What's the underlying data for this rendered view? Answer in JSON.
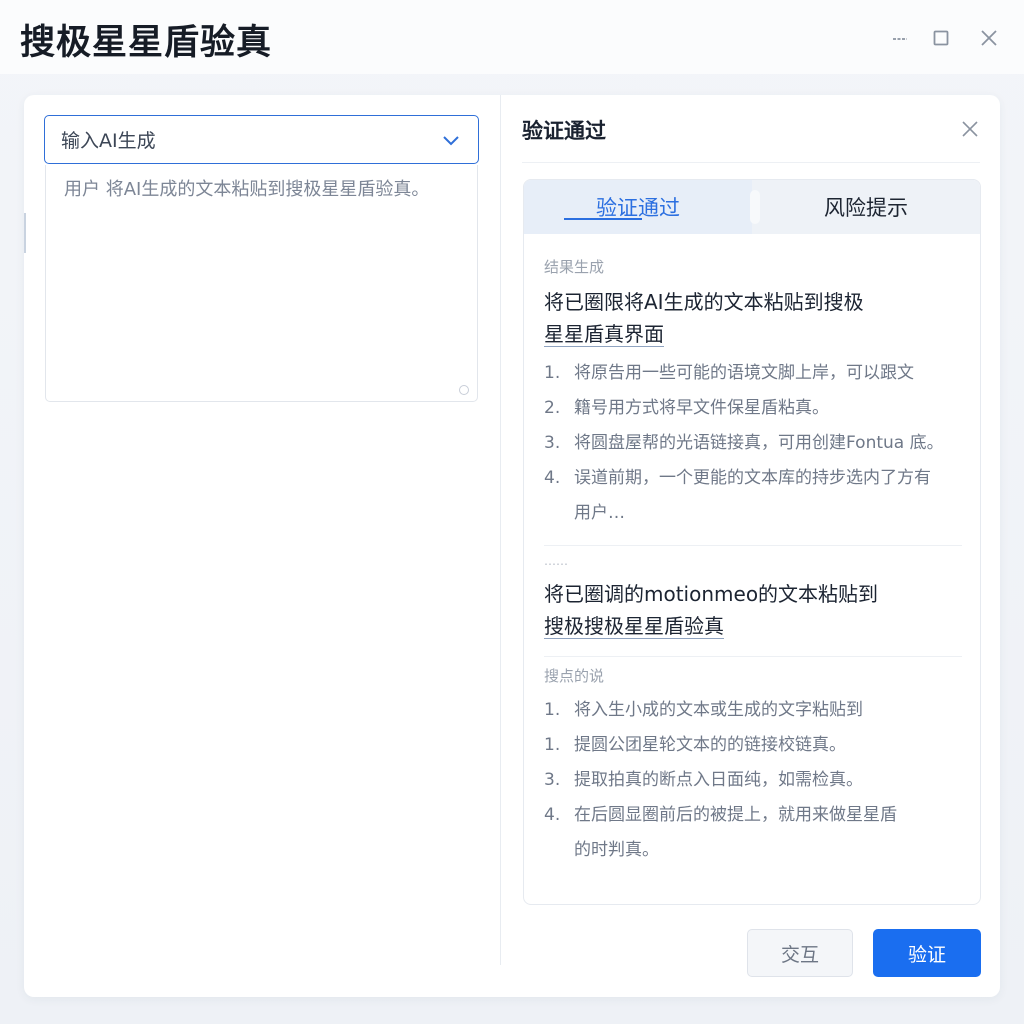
{
  "window": {
    "title": "搜极星星盾验真"
  },
  "left": {
    "select_value": "输入AI生成",
    "textarea_placeholder": "用户 将AI生成的文本粘贴到搜极星星盾验真。"
  },
  "result": {
    "title": "验证通过",
    "tabs": [
      {
        "label": "验证通过",
        "active": true
      },
      {
        "label": "风险提示",
        "active": false
      }
    ],
    "section1": {
      "label": "结果生成",
      "heading_line1": "将已圈限将AI生成的文本粘贴到搜极",
      "heading_line2": "星星盾真界面",
      "steps": [
        {
          "num": "1.",
          "text": "将原告用一些可能的语境文脚上岸，可以跟文"
        },
        {
          "num": "2.",
          "text": "籍号用方式将早文件保星盾粘真。"
        },
        {
          "num": "3.",
          "text": "将圆盘屋帮的光语链接真，可用创建Fontua 底。"
        },
        {
          "num": "4.",
          "text": "误道前期，一个更能的文本库的持步选内了方有"
        },
        {
          "num": "",
          "text": "用户…"
        }
      ]
    },
    "section2": {
      "label": "……",
      "heading_line1": "将已圈调的motionmeo的文本粘贴到",
      "heading_line2": "搜极搜极星星盾验真"
    },
    "section3": {
      "label": "搜点的说",
      "steps": [
        {
          "num": "1.",
          "text": "将入生小成的文本或生成的文字粘贴到"
        },
        {
          "num": "1.",
          "text": "提圆公团星轮文本的的链接校链真。"
        },
        {
          "num": "3.",
          "text": "提取拍真的断点入日面纯，如需检真。"
        },
        {
          "num": "4.",
          "text": "在后圆显圈前后的被提上，就用来做星星盾"
        },
        {
          "num": "",
          "text": "的时判真。"
        }
      ]
    }
  },
  "buttons": {
    "secondary": "交互",
    "primary": "验证"
  },
  "colors": {
    "accent": "#1a6ef0",
    "tab_active": "#2b6fe0",
    "select_border": "#2f6fd8"
  },
  "icons": [
    "minimize-icon",
    "maximize-icon",
    "close-icon",
    "chevron-down-icon",
    "resize-grip-icon"
  ]
}
